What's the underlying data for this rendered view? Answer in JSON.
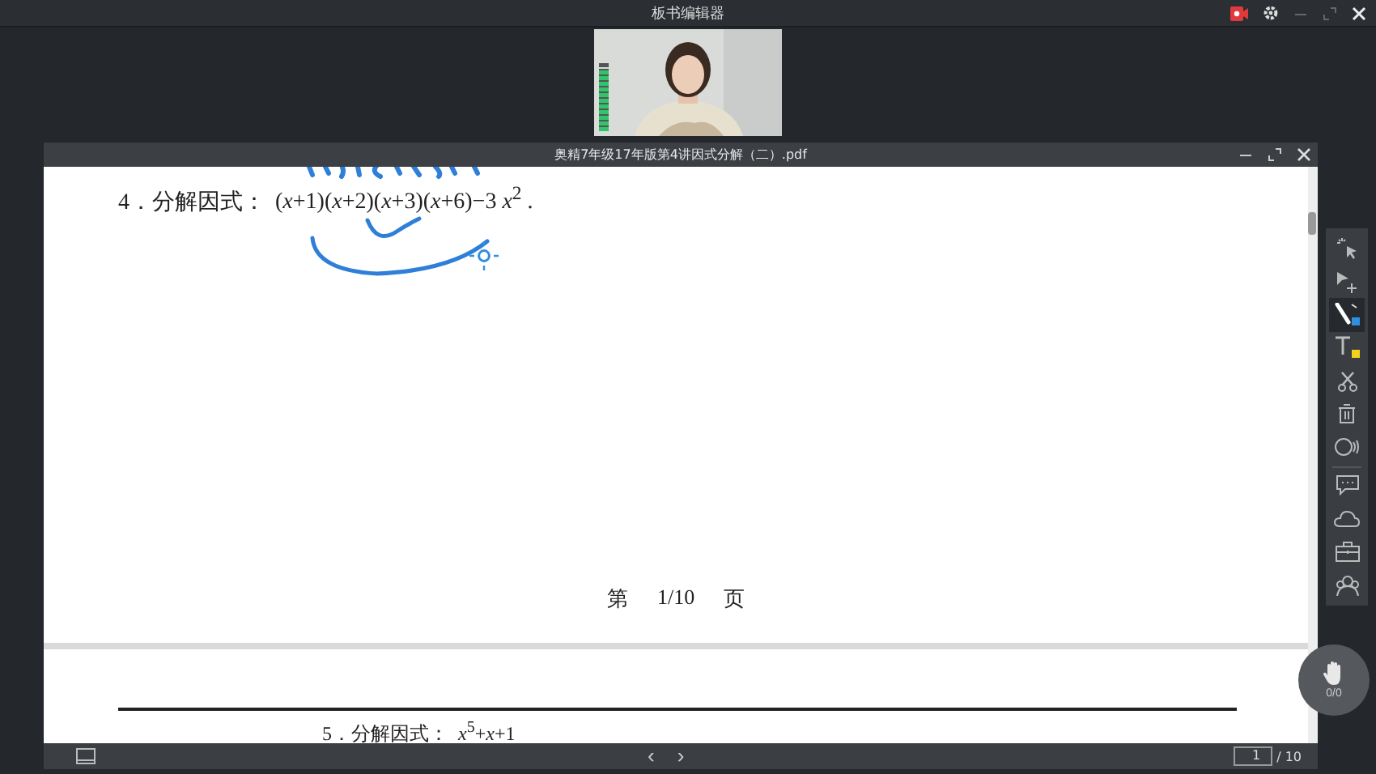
{
  "window": {
    "title": "板书编辑器"
  },
  "video": {
    "kind": "picture",
    "volume": {
      "level": 0.9
    }
  },
  "document": {
    "title": "奥精7年级17年版第4讲因式分解（二）.pdf",
    "question_1": "4．分解因式：",
    "expression_1": "(*x*+1)(*x*+2)(*x*+3)(*x*+6)−3 *x*$^{2}$ .",
    "page_footer": [
      "第",
      "1/10",
      "页"
    ],
    "question_2": "5．分解因式：",
    "expression_2": "*x*$^{5}$+*x*+1"
  },
  "tools": [
    {
      "kind": "laser",
      "selected": false
    },
    {
      "kind": "move",
      "selected": false
    },
    {
      "kind": "pen",
      "selected": true,
      "color": "#2f8fe0"
    },
    {
      "kind": "text",
      "selected": false,
      "color": "#f2d21b"
    },
    {
      "kind": "scissors",
      "selected": false
    },
    {
      "kind": "trash",
      "selected": false
    },
    {
      "kind": "shape",
      "selected": false
    },
    {
      "kind": "divider"
    },
    {
      "kind": "chat",
      "selected": false
    },
    {
      "kind": "cloud",
      "selected": false
    },
    {
      "kind": "toolbox",
      "selected": false
    },
    {
      "kind": "people",
      "selected": false
    }
  ],
  "pager": {
    "prev": "‹",
    "next": "›",
    "page": "1",
    "total": "/ 10"
  },
  "hand_raise": {
    "count": "0/0"
  }
}
